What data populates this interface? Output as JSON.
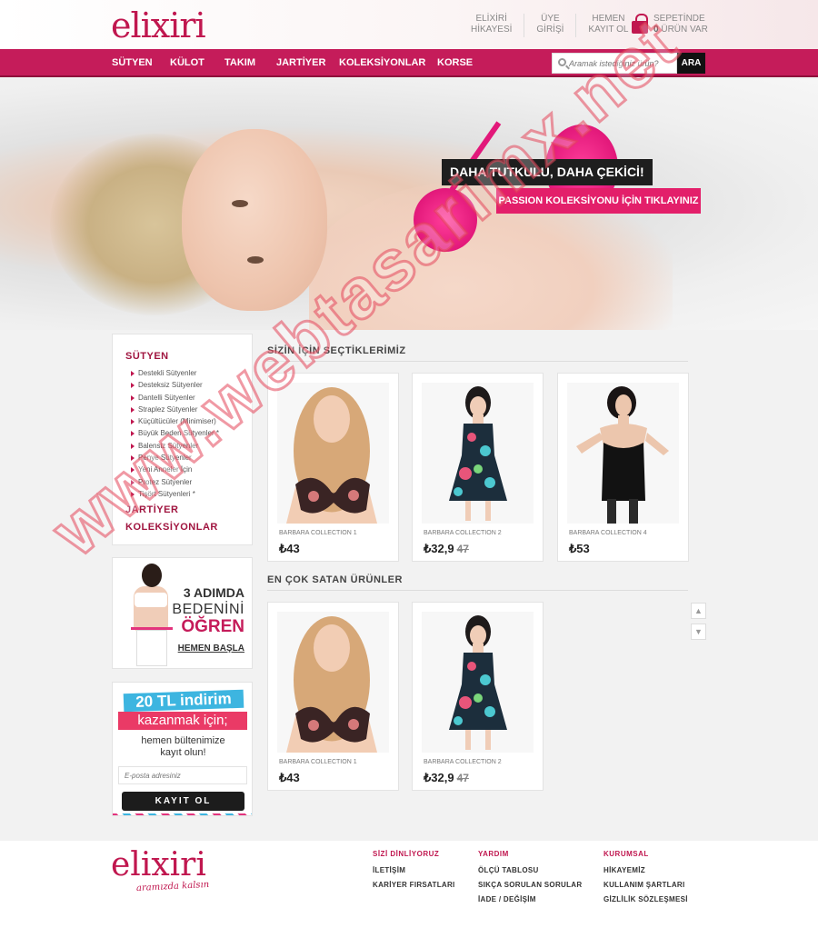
{
  "brand": {
    "logo": "elixiri",
    "slogan": "aramızda kalsın"
  },
  "header": {
    "links": [
      {
        "line1": "ELİXİRİ",
        "line2": "HİKAYESİ"
      },
      {
        "line1": "ÜYE",
        "line2": "GİRİŞİ"
      },
      {
        "line1": "HEMEN",
        "line2": "KAYIT OL"
      }
    ],
    "cart": {
      "line1": "SEPETİNDE",
      "count": "0",
      "line2_suffix": "ÜRÜN VAR"
    }
  },
  "nav": {
    "items": [
      "SÜTYEN",
      "KÜLOT",
      "TAKIM",
      "JARTİYER",
      "KOLEKSİYONLAR",
      "KORSE"
    ]
  },
  "search": {
    "placeholder": "Aramak istediğiniz ürün?",
    "button": "ARA"
  },
  "hero": {
    "title": "DAHA TUTKULU, DAHA ÇEKİCİ!",
    "cta": "PASSION KOLEKSİYONU İÇİN TIKLAYINIZ"
  },
  "sidebar": {
    "heading": "SÜTYEN",
    "items": [
      "Destekli Sütyenler",
      "Desteksiz Sütyenler",
      "Dantelli Sütyenler",
      "Straplez Sütyenler",
      "Küçültücüler (Minimiser)",
      "Büyük Beden Sütyenler *",
      "Balensiz Sütyenler",
      "Penye Sütyenler",
      "Yeni Anneler İçin",
      "Protez Sütyenler",
      "Tişört Sütyenleri *"
    ],
    "jartiyer": "JARTİYER",
    "koleksiyonlar": "KOLEKSİYONLAR"
  },
  "promo1": {
    "line1": "3 ADIMDA",
    "line2": "BEDENİNİ",
    "line3": "ÖĞREN",
    "link": "HEMEN BAŞLA"
  },
  "promo2": {
    "line1": "20 TL indirim",
    "line2": "kazanmak için;",
    "line3": "hemen bültenimize",
    "line4": "kayıt olun!",
    "placeholder": "E-posta adresiniz",
    "button": "KAYIT OL"
  },
  "picks": {
    "title": "SİZİN İÇİN SEÇTİKLERİMİZ",
    "products": [
      {
        "name": "BARBARA COLLECTION 1",
        "price": "₺43",
        "old": ""
      },
      {
        "name": "BARBARA COLLECTION 2",
        "price": "₺32,9",
        "old": "47"
      },
      {
        "name": "BARBARA COLLECTION 4",
        "price": "₺53",
        "old": ""
      }
    ]
  },
  "bestsellers": {
    "title": "EN ÇOK SATAN ÜRÜNLER",
    "products": [
      {
        "name": "BARBARA COLLECTION 1",
        "price": "₺43",
        "old": ""
      },
      {
        "name": "BARBARA COLLECTION 2",
        "price": "₺32,9",
        "old": "47"
      }
    ]
  },
  "footer": {
    "col1": {
      "title": "SİZİ DİNLİYORUZ",
      "links": [
        "İLETİŞİM",
        "KARİYER FIRSATLARI"
      ]
    },
    "col2": {
      "title": "YARDIM",
      "links": [
        "ÖLÇÜ TABLOSU",
        "SIKÇA SORULAN SORULAR",
        "İADE / DEĞİŞİM"
      ]
    },
    "col3": {
      "title": "KURUMSAL",
      "links": [
        "HİKAYEMİZ",
        "KULLANIM ŞARTLARI",
        "GİZLİLİK SÖZLEŞMESİ"
      ]
    }
  },
  "watermark": "www.webtasarimx.net",
  "colors": {
    "brand": "#c51c5a",
    "cta": "#e31f6a",
    "dark": "#1e1e1e"
  }
}
